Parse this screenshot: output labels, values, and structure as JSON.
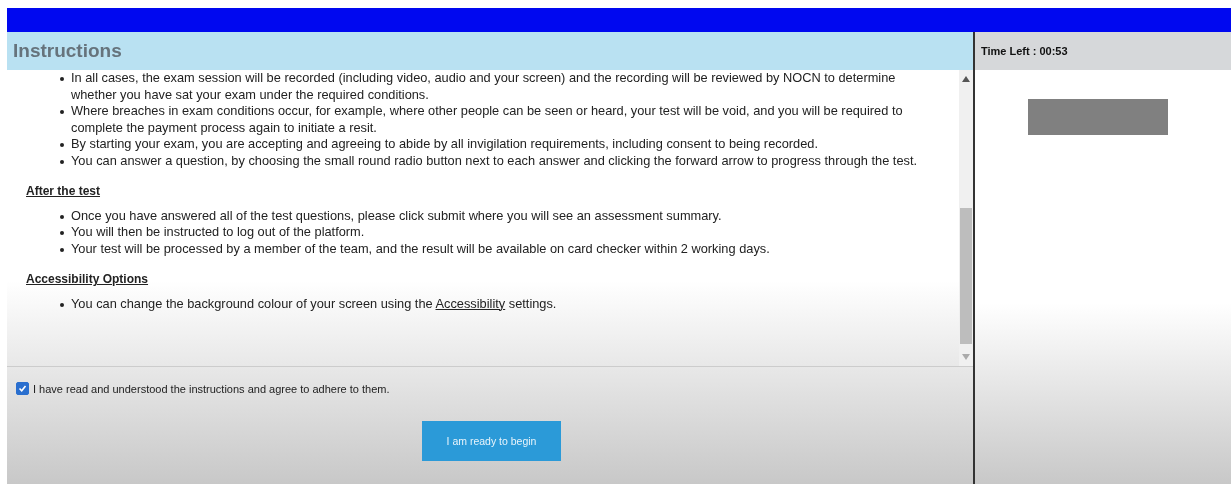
{
  "header": {
    "title": "Instructions"
  },
  "timer": {
    "label": "Time Left : 00:53"
  },
  "sections": [
    {
      "items": [
        "In all cases, the exam session will be recorded (including video, audio and your screen) and the recording will be reviewed by NOCN to determine whether you have sat your exam under the required conditions.",
        "Where breaches in exam conditions occur, for example, where other people can be seen or heard, your test will be void, and you will be required to complete the payment process again to initiate a resit.",
        "By starting your exam, you are accepting and agreeing to abide by all invigilation requirements, including consent to being recorded.",
        "You can answer a question, by choosing the small round radio button next to each answer and clicking the forward arrow to progress through the test."
      ]
    },
    {
      "heading": "After the test",
      "items": [
        "Once you have answered all of the test questions, please click submit where you will see an assessment summary.",
        "You will then be instructed to log out of the platform.",
        "Your test will be processed by a member of the team, and the result will be available on card checker within 2 working days."
      ]
    },
    {
      "heading": "Accessibility Options",
      "items": [
        {
          "before": "You can change the background colour of your screen using the ",
          "link": "Accessibility",
          "after": " settings."
        }
      ]
    }
  ],
  "agreement": {
    "label": "I have read and understood the instructions and agree to adhere to them.",
    "checked": true
  },
  "start_button": {
    "label": "I am ready to begin"
  }
}
